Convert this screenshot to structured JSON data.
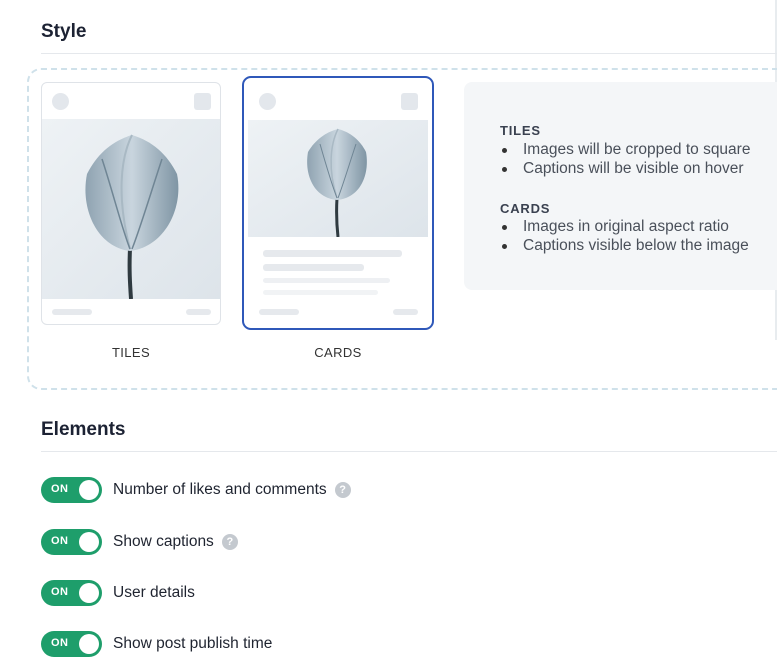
{
  "style_section": {
    "title": "Style"
  },
  "layout_options": [
    {
      "id": "tiles",
      "label": "TILES",
      "selected": false
    },
    {
      "id": "cards",
      "label": "CARDS",
      "selected": true
    }
  ],
  "info": {
    "tiles": {
      "heading": "TILES",
      "points": [
        "Images will be cropped to square",
        "Captions will be visible on hover"
      ]
    },
    "cards": {
      "heading": "CARDS",
      "points": [
        "Images in original aspect ratio",
        "Captions visible below the image"
      ]
    }
  },
  "elements_section": {
    "title": "Elements",
    "toggles": [
      {
        "label": "Number of likes and comments",
        "state": "ON",
        "help": true
      },
      {
        "label": "Show captions",
        "state": "ON",
        "help": true
      },
      {
        "label": "User details",
        "state": "ON",
        "help": false
      },
      {
        "label": "Show post publish time",
        "state": "ON",
        "help": false
      }
    ]
  },
  "colors": {
    "toggle_on": "#1e9e6b",
    "selected_border": "#2f58b9",
    "dashed_border": "#cfe1ea"
  },
  "icons": {
    "help": "question-circle-icon",
    "image": "tulip-photo"
  }
}
